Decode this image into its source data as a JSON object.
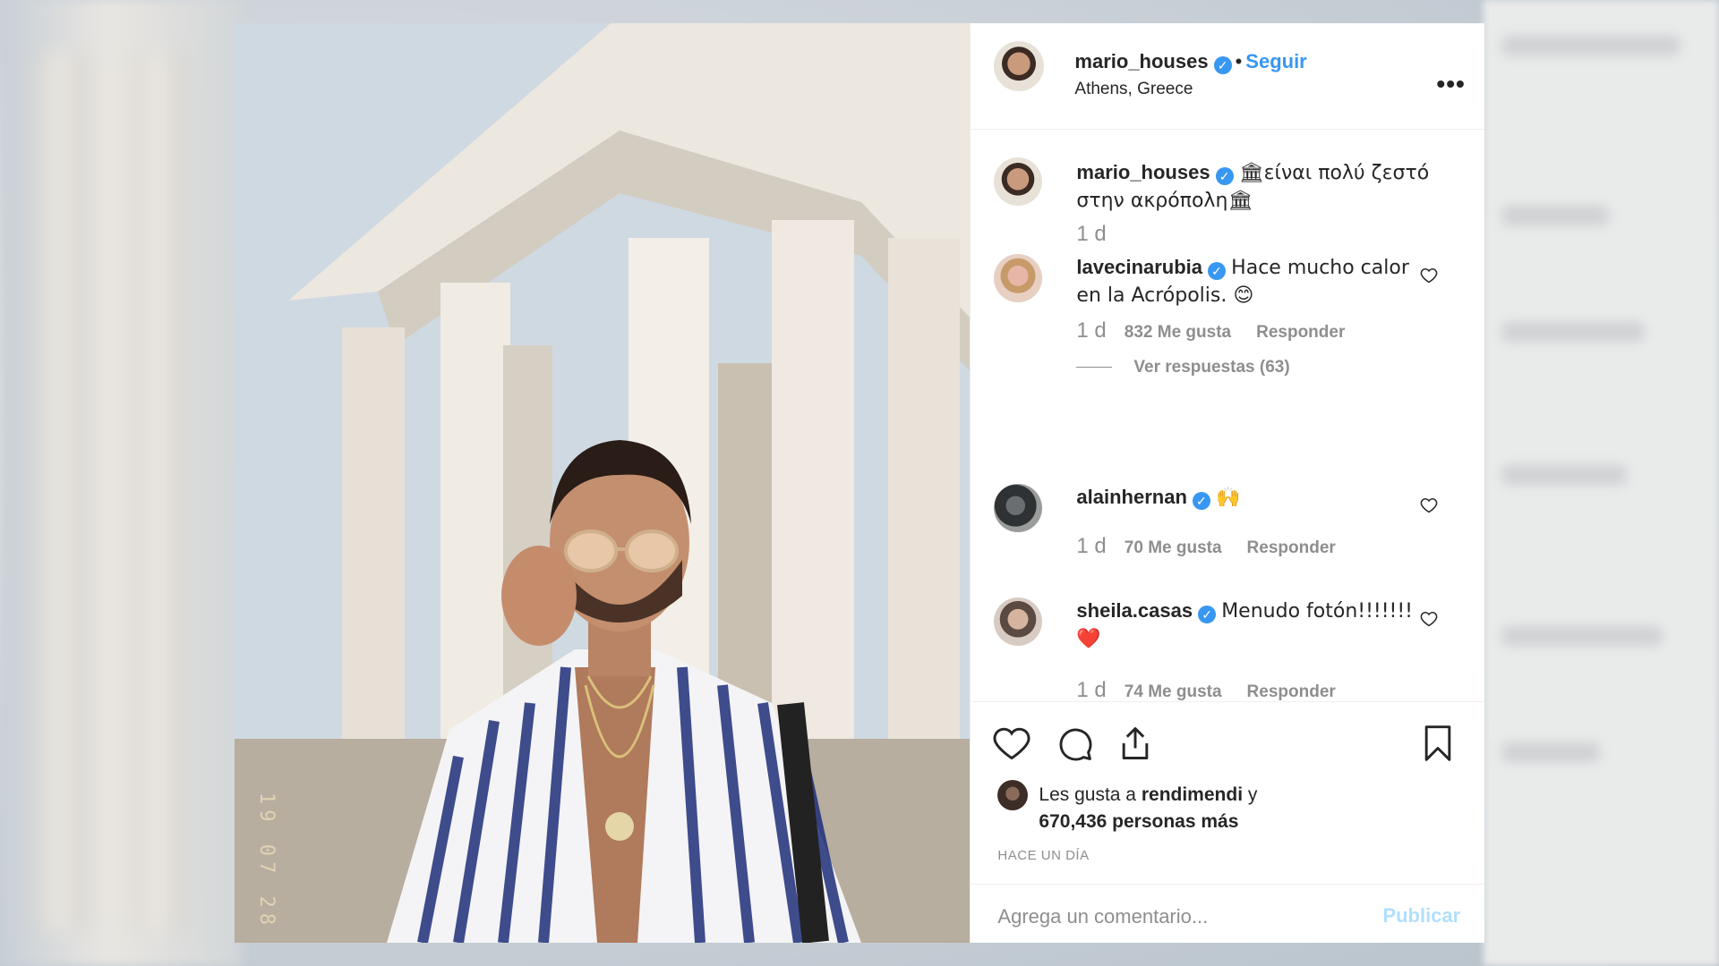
{
  "post": {
    "author": "mario_houses",
    "follow_label": "Seguir",
    "separator": "•",
    "location": "Athens, Greece",
    "more_label": "•••",
    "caption": {
      "username": "mario_houses",
      "text": "🏛είναι πολύ ζεστό στην ακρόπολη🏛",
      "age": "1 d"
    },
    "comments": [
      {
        "username": "lavecinarubia",
        "text": "Hace mucho calor en la Acrópolis. 😊",
        "age": "1 d",
        "likes": "832 Me gusta",
        "reply": "Responder",
        "view_replies": "Ver respuestas (63)"
      },
      {
        "username": "alainhernan",
        "text": "🙌",
        "age": "1 d",
        "likes": "70 Me gusta",
        "reply": "Responder"
      },
      {
        "username": "sheila.casas",
        "text": "Menudo fotón!!!!!!! ❤️",
        "age": "1 d",
        "likes": "74 Me gusta",
        "reply": "Responder"
      }
    ],
    "likes_summary": {
      "prefix": "Les gusta a",
      "user": "rendimendi",
      "joiner": "y",
      "count": "670,436 personas más"
    },
    "posted_ago": "HACE UN DÍA",
    "add_comment_placeholder": "Agrega un comentario...",
    "publish_label": "Publicar",
    "photo_date_stamp": "19 07 28"
  },
  "icons": {
    "verified": "verified-badge-icon",
    "like": "heart-icon",
    "comment": "comment-bubble-icon",
    "share": "share-icon",
    "save": "bookmark-icon",
    "more": "ellipsis-icon"
  },
  "colors": {
    "link_blue": "#3897f0",
    "publish_disabled": "#b2dffc",
    "muted_text": "#8e8e8e",
    "text": "#262626"
  }
}
